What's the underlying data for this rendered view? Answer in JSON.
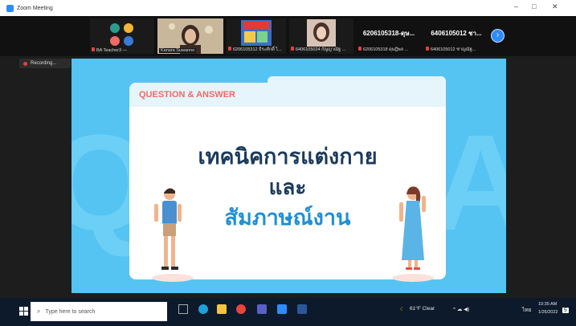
{
  "window": {
    "title": "Zoom Meeting",
    "controls": [
      "–",
      "□",
      "✕"
    ]
  },
  "participants": [
    {
      "name": "BA Teacher3 —",
      "muted": true
    },
    {
      "name": "Kanara Suwanno",
      "muted": false
    },
    {
      "name": "6206105312 ธีระศักดิ์ ไ...",
      "muted": true
    },
    {
      "name": "6406105024 กัญญาณัฐ ...",
      "muted": true
    },
    {
      "name": "6206105318 ดุษฎีพล ...",
      "muted": true,
      "display": "6206105318-ดุษ..."
    },
    {
      "name": "6406105012 ชาญณัฐ...",
      "muted": true,
      "display": "6406105012 ชา..."
    }
  ],
  "next_icon": "chevron-right-icon",
  "recording_label": "Recording...",
  "slide": {
    "header": "QUESTION & ANSWER",
    "title_line1": "เทคนิคการแต่งกาย",
    "title_line2": "และ",
    "title_line3": "สัมภาษณ์งาน",
    "watermark_left": "Q",
    "watermark_right": "A",
    "colors": {
      "background": "#55c4f2",
      "header_text": "#ef6b63",
      "title": "#1b3a5c",
      "accent": "#1f8fd6"
    }
  },
  "taskbar": {
    "search_placeholder": "Type here to search",
    "weather": "61°F Clear",
    "lang": "ไทย",
    "time": "10:35 AM",
    "date": "1/26/2022",
    "notification_count": "5",
    "tray_symbols": "^ ☁ ◀)",
    "pinned_icons": [
      "task-view-icon",
      "edge-icon",
      "file-explorer-icon",
      "chrome-icon",
      "teams-icon",
      "zoom-icon",
      "word-icon"
    ]
  }
}
